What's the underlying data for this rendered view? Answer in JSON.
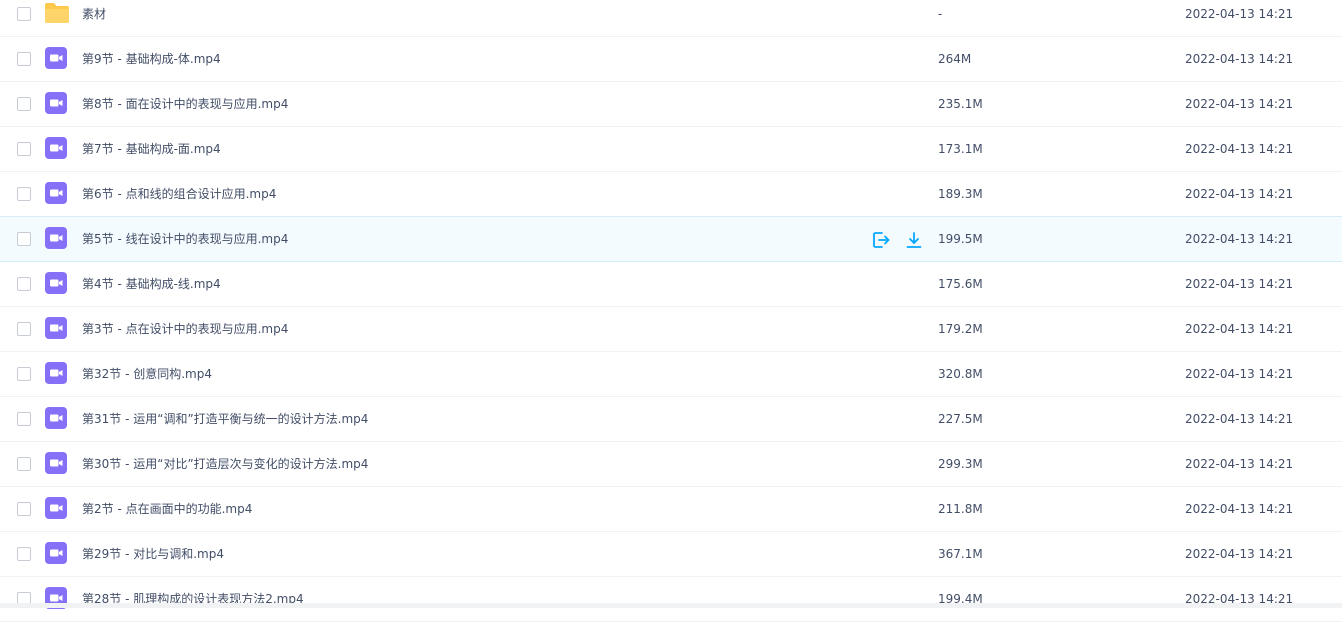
{
  "colors": {
    "accent": "#06a7ff",
    "video_icon": "#8670f7",
    "folder_icon": "#ffc94d",
    "hover_row": "#f4fbff"
  },
  "row_actions": {
    "share_icon": "share-icon",
    "download_icon": "download-icon"
  },
  "files": [
    {
      "type": "folder",
      "icon": "folder-icon",
      "name": "素材",
      "size": "-",
      "date": "2022-04-13 14:21"
    },
    {
      "type": "video",
      "icon": "video-icon",
      "name": "第9节 - 基础构成-体.mp4",
      "size": "264M",
      "date": "2022-04-13 14:21"
    },
    {
      "type": "video",
      "icon": "video-icon",
      "name": "第8节 - 面在设计中的表现与应用.mp4",
      "size": "235.1M",
      "date": "2022-04-13 14:21"
    },
    {
      "type": "video",
      "icon": "video-icon",
      "name": "第7节 - 基础构成-面.mp4",
      "size": "173.1M",
      "date": "2022-04-13 14:21"
    },
    {
      "type": "video",
      "icon": "video-icon",
      "name": "第6节 - 点和线的组合设计应用.mp4",
      "size": "189.3M",
      "date": "2022-04-13 14:21"
    },
    {
      "type": "video",
      "icon": "video-icon",
      "name": "第5节 - 线在设计中的表现与应用.mp4",
      "size": "199.5M",
      "date": "2022-04-13 14:21",
      "hovered": true
    },
    {
      "type": "video",
      "icon": "video-icon",
      "name": "第4节 - 基础构成-线.mp4",
      "size": "175.6M",
      "date": "2022-04-13 14:21"
    },
    {
      "type": "video",
      "icon": "video-icon",
      "name": "第3节 - 点在设计中的表现与应用.mp4",
      "size": "179.2M",
      "date": "2022-04-13 14:21"
    },
    {
      "type": "video",
      "icon": "video-icon",
      "name": "第32节 - 创意同构.mp4",
      "size": "320.8M",
      "date": "2022-04-13 14:21"
    },
    {
      "type": "video",
      "icon": "video-icon",
      "name": "第31节 - 运用“调和”打造平衡与统一的设计方法.mp4",
      "size": "227.5M",
      "date": "2022-04-13 14:21"
    },
    {
      "type": "video",
      "icon": "video-icon",
      "name": "第30节 - 运用“对比”打造层次与变化的设计方法.mp4",
      "size": "299.3M",
      "date": "2022-04-13 14:21"
    },
    {
      "type": "video",
      "icon": "video-icon",
      "name": "第2节 - 点在画面中的功能.mp4",
      "size": "211.8M",
      "date": "2022-04-13 14:21"
    },
    {
      "type": "video",
      "icon": "video-icon",
      "name": "第29节 - 对比与调和.mp4",
      "size": "367.1M",
      "date": "2022-04-13 14:21"
    },
    {
      "type": "video",
      "icon": "video-icon",
      "name": "第28节 - 肌理构成的设计表现方法2.mp4",
      "size": "199.4M",
      "date": "2022-04-13 14:21"
    }
  ]
}
